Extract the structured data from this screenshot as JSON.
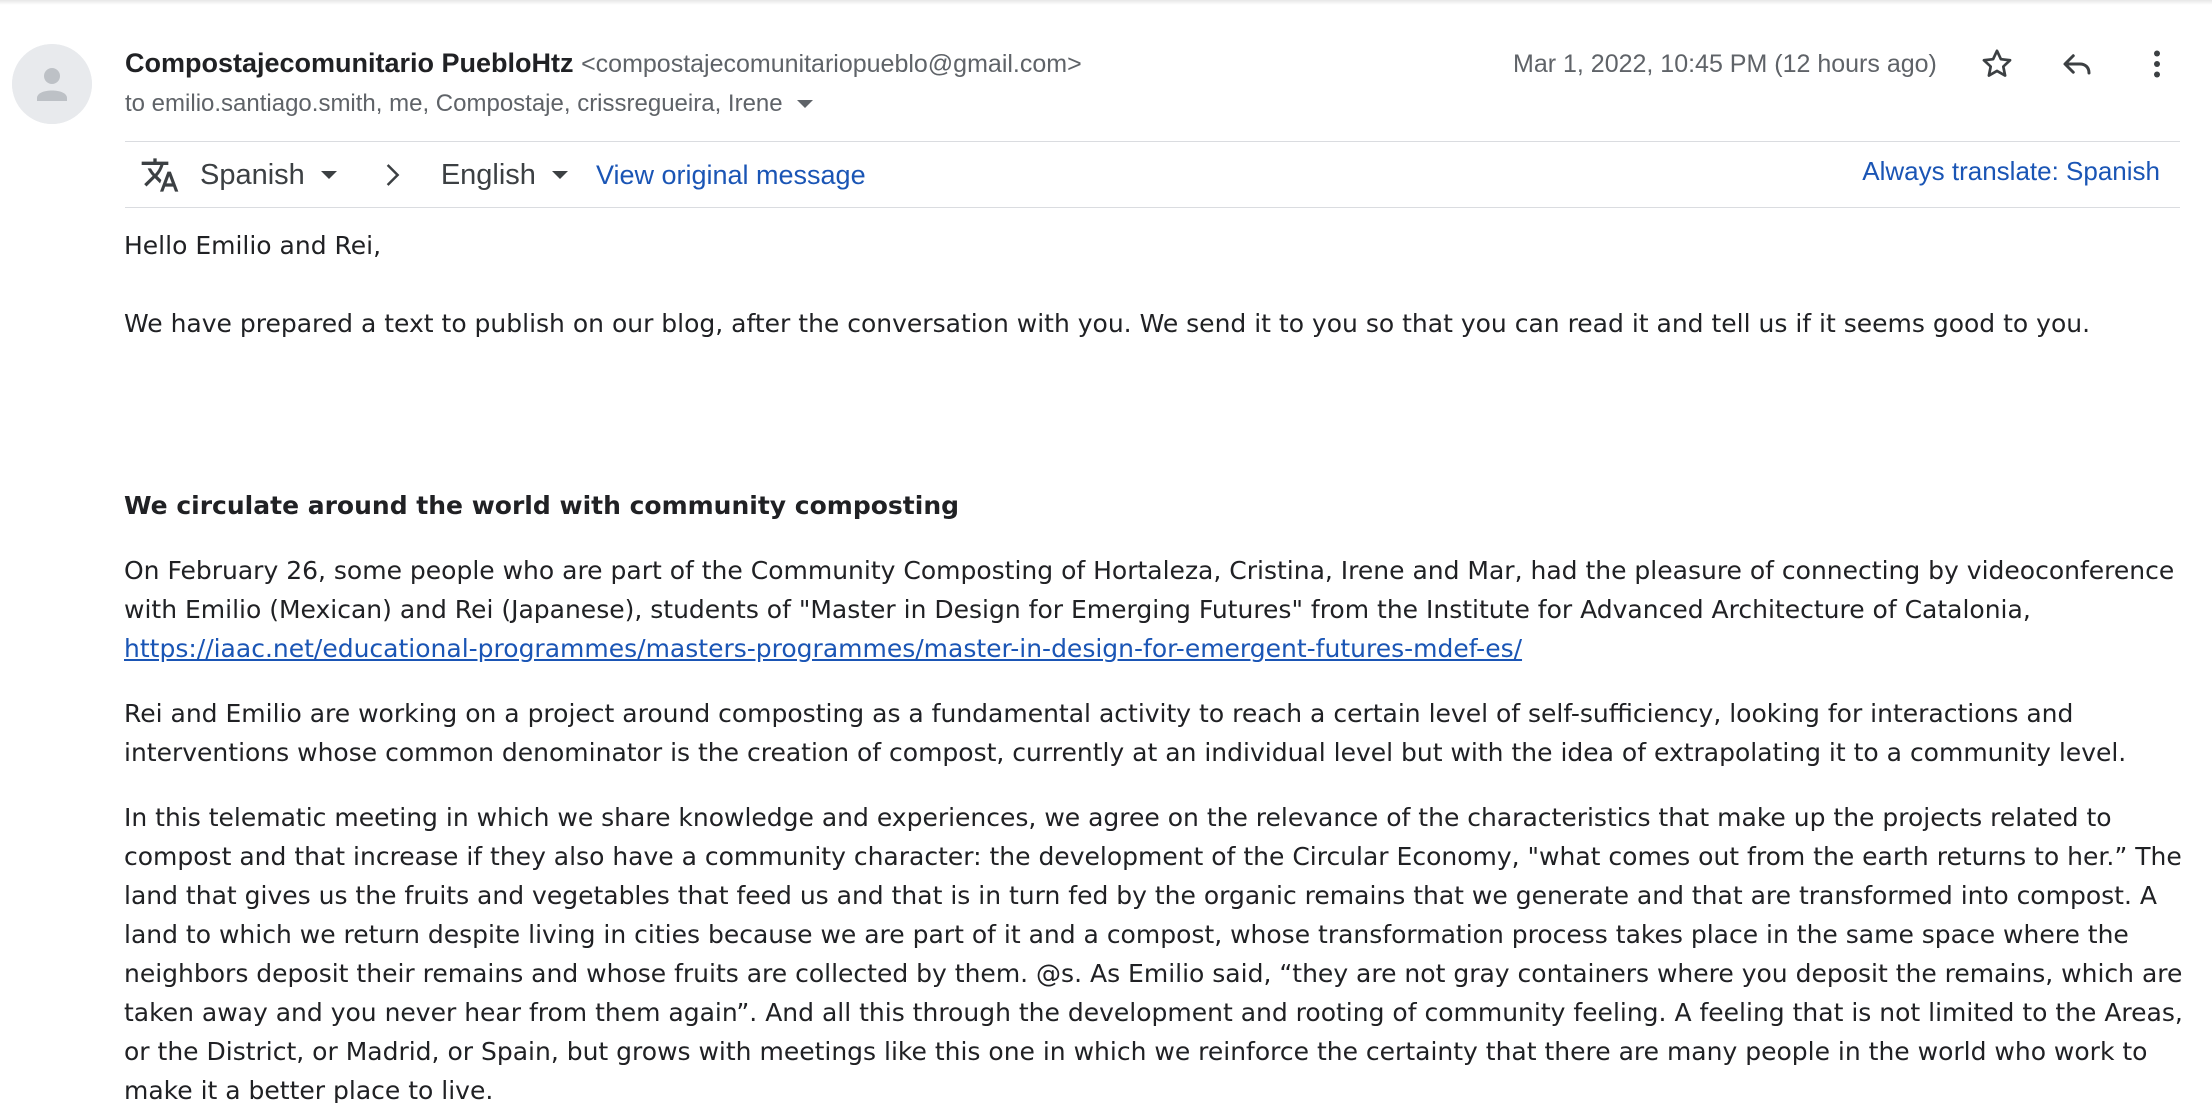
{
  "email": {
    "sender_name": "Compostajecomunitario PuebloHtz",
    "sender_email": "<compostajecomunitariopueblo@gmail.com>",
    "recipients": "to emilio.santiago.smith, me, Compostaje, crissregueira, Irene",
    "date": "Mar 1, 2022, 10:45 PM (12 hours ago)"
  },
  "icons": {
    "avatar": "person-avatar-icon",
    "star": "star-icon",
    "reply": "reply-icon",
    "more": "more-vertical-icon",
    "translate": "translate-icon",
    "arrow": "chevron-right-icon"
  },
  "translate": {
    "source_lang": "Spanish",
    "target_lang": "English",
    "view_original": "View original message",
    "always_translate": "Always translate: Spanish"
  },
  "body": {
    "greeting": "Hello Emilio and Rei,",
    "intro": "We have prepared a text to publish on our blog, after the conversation with you. We send it to you so that you can read it and tell us if it seems good to you.",
    "heading": "We circulate around the world with community composting",
    "p1_text": "On February 26, some people who are part of the Community Composting of Hortaleza, Cristina, Irene and Mar, had the pleasure of connecting by videoconference with Emilio (Mexican) and Rei (Japanese), students of \"Master in Design for Emerging Futures\" from the Institute for Advanced Architecture of Catalonia,",
    "p1_link": "https://iaac.net/educational-programmes/masters-programmes/master-in-design-for-emergent-futures-mdef-es/",
    "p2": "Rei and Emilio are working on a project around composting as a fundamental activity to reach a certain level of self-sufficiency, looking for interactions and interventions whose common denominator is the creation of compost, currently at an individual level but with the idea of extrapolating it to a community level.",
    "p3": "In this telematic meeting in which we share knowledge and experiences, we agree on the relevance of the characteristics that make up the projects related to compost and that increase if they also have a community character: the development of the Circular Economy, \"what comes out from the earth returns to her.” The land that gives us the fruits and vegetables that feed us and that is in turn fed by the organic remains that we generate and that are transformed into compost. A land to which we return despite living in cities because we are part of it and a compost, whose transformation process takes place in the same space where the neighbors deposit their remains and whose fruits are collected by them. @s. As Emilio said, “they are not gray containers where you deposit the remains, which are taken away and you never hear from them again”. And all this through the development and rooting of community feeling. A feeling that is not limited to the Areas, or the District, or Madrid, or Spain, but grows with meetings like this one in which we reinforce the certainty that there are many people in the world who work to make it a better place to live."
  }
}
